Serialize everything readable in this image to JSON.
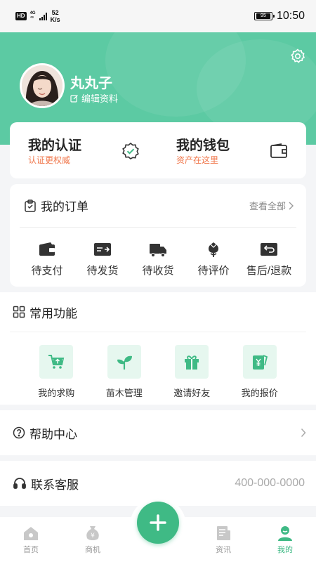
{
  "status_bar": {
    "hd": "HD",
    "net_top": "4G",
    "net_bottom": "⁴⁶",
    "speed_value": "52",
    "speed_unit": "K/s",
    "battery": "95",
    "time": "10:50"
  },
  "profile": {
    "name": "丸丸子",
    "edit_label": "编辑资料"
  },
  "auth_card": [
    {
      "title": "我的认证",
      "subtitle": "认证更权威",
      "icon": "verified-badge-icon"
    },
    {
      "title": "我的钱包",
      "subtitle": "资产在这里",
      "icon": "wallet-icon"
    }
  ],
  "orders": {
    "title": "我的订单",
    "view_all": "查看全部",
    "items": [
      {
        "label": "待支付",
        "icon": "wallet-icon"
      },
      {
        "label": "待发货",
        "icon": "shipment-icon"
      },
      {
        "label": "待收货",
        "icon": "truck-icon"
      },
      {
        "label": "待评价",
        "icon": "flower-icon"
      },
      {
        "label": "售后/退款",
        "icon": "refund-icon"
      }
    ]
  },
  "functions": {
    "title": "常用功能",
    "items": [
      {
        "label": "我的求购",
        "icon": "cart-icon"
      },
      {
        "label": "苗木管理",
        "icon": "sprout-icon"
      },
      {
        "label": "邀请好友",
        "icon": "gift-icon"
      },
      {
        "label": "我的报价",
        "icon": "price-tag-icon"
      }
    ]
  },
  "help": {
    "label": "帮助中心"
  },
  "contact": {
    "label": "联系客服",
    "phone": "400-000-0000"
  },
  "tabbar": {
    "items": [
      {
        "label": "首页",
        "icon": "home-icon"
      },
      {
        "label": "商机",
        "icon": "money-bag-icon"
      },
      {
        "label": "资讯",
        "icon": "news-icon"
      },
      {
        "label": "我的",
        "icon": "profile-icon"
      }
    ],
    "active": "我的"
  },
  "colors": {
    "brand": "#3fba85",
    "header": "#5ccaa3",
    "accent_orange": "#f0764a"
  }
}
